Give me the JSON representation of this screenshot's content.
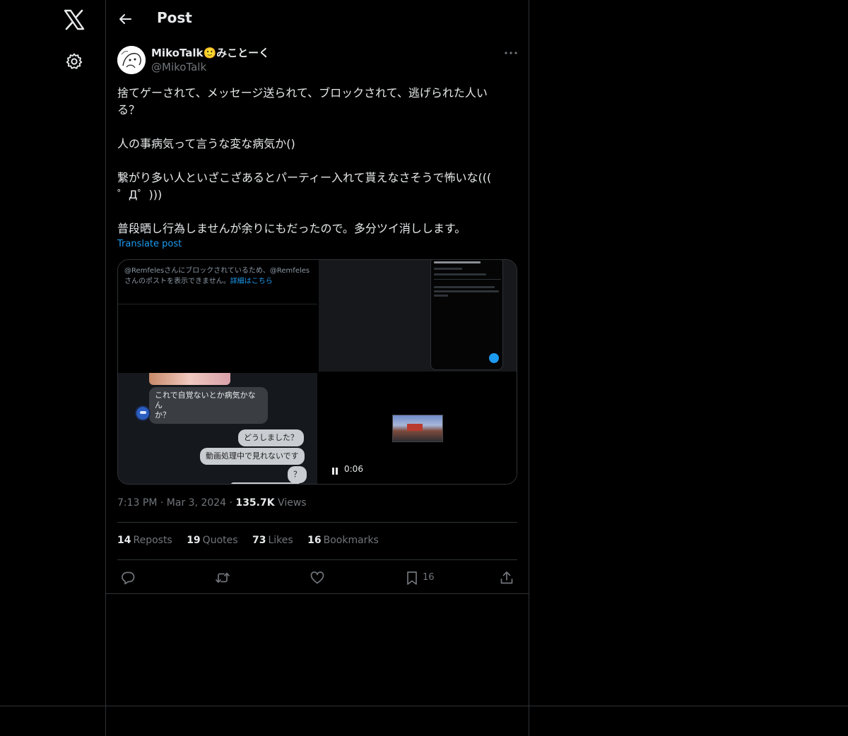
{
  "header": {
    "title": "Post"
  },
  "author": {
    "name": "MikoTalk🙂みことーく",
    "handle": "@MikoTalk"
  },
  "post": {
    "text": "捨てゲーされて、メッセージ送られて、ブロックされて、逃げられた人い\nる？\n\n人の事病気って言うな変な病気か()\n\n繋がり多い人といざこざあるとパーティー入れて貰えなさそうで怖いな(((\n゜Д゜)))\n\n普段晒し行為しませんが余りにもだったので。多分ツイ消しします。",
    "translate_label": "Translate post"
  },
  "media": {
    "tile1": {
      "notice": "@Remfelesさんにブロックされているため、@Remfelesさんのポストを表示できません。",
      "notice_link": "詳細はこちら"
    },
    "tile3": {
      "bubble_in": "これで自覚ないとか病気かなん\nか？",
      "bubble_out_1": "どうしました？",
      "bubble_out_2": "動画処理中で見れないです",
      "bubble_out_3": "？"
    },
    "tile4": {
      "video_time": "0:06"
    }
  },
  "meta": {
    "time": "7:13 PM",
    "date": "Mar 3, 2024",
    "views_count": "135.7K",
    "views_label": "Views"
  },
  "stats": {
    "reposts_count": "14",
    "reposts_label": "Reposts",
    "quotes_count": "19",
    "quotes_label": "Quotes",
    "likes_count": "73",
    "likes_label": "Likes",
    "bookmarks_count": "16",
    "bookmarks_label": "Bookmarks"
  },
  "actions": {
    "bookmark_count": "16"
  },
  "colors": {
    "accent": "#1d9bf0",
    "background": "#000000",
    "border": "#2f3336",
    "muted": "#71767b",
    "text": "#e7e9ea"
  },
  "icons": [
    "x-logo-icon",
    "gear-icon",
    "back-arrow-icon",
    "more-icon",
    "reply-icon",
    "repost-icon",
    "like-icon",
    "bookmark-icon",
    "share-icon",
    "pause-icon"
  ]
}
